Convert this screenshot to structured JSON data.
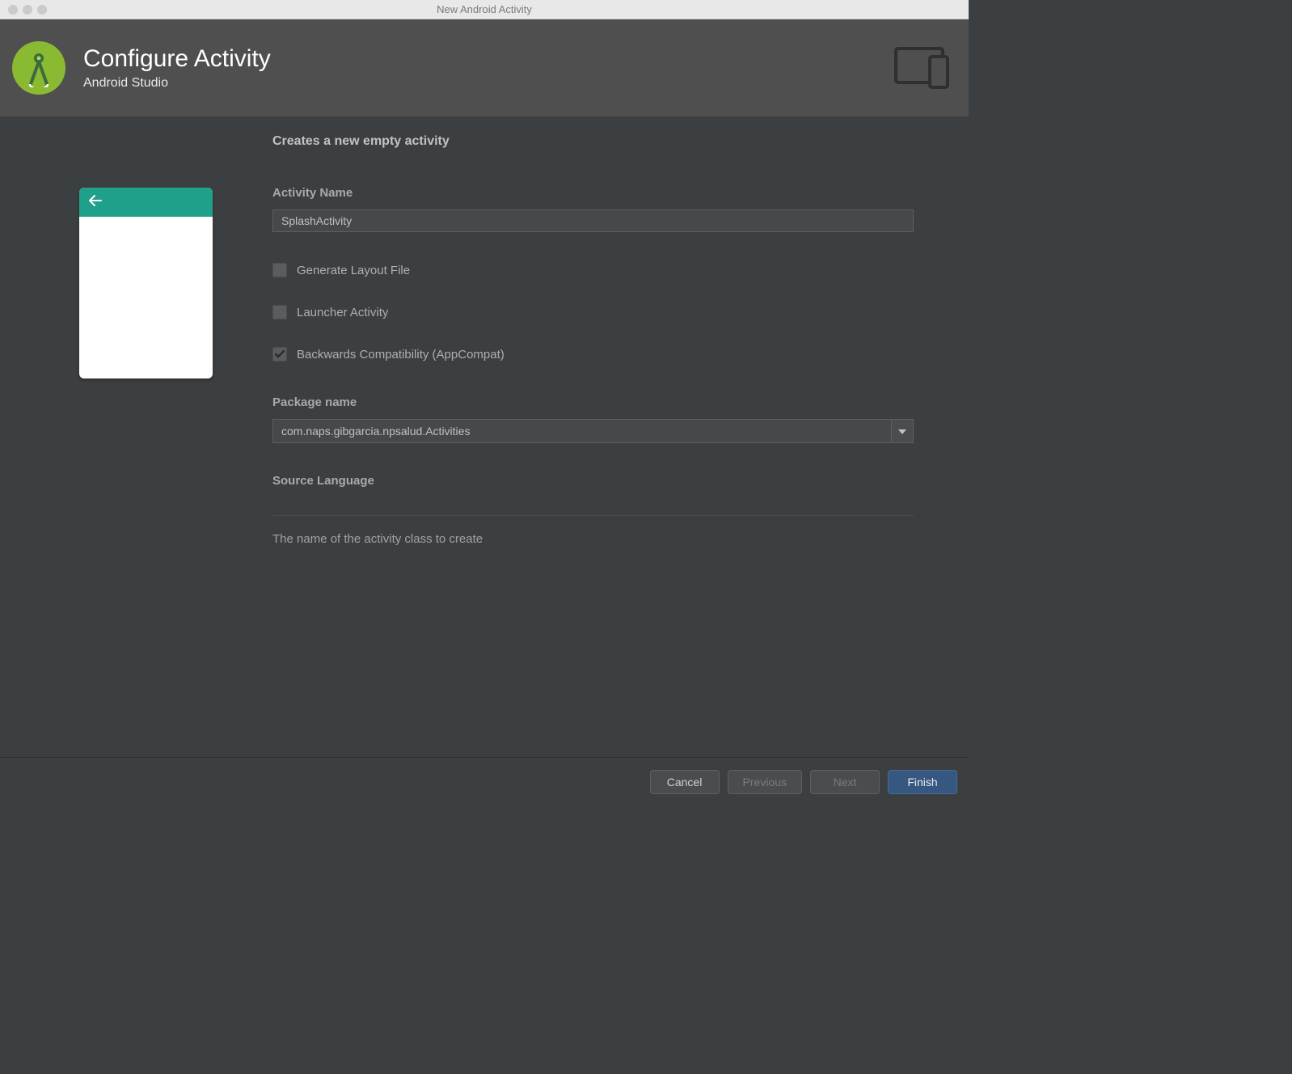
{
  "window": {
    "title": "New Android Activity"
  },
  "header": {
    "title": "Configure Activity",
    "subtitle": "Android Studio"
  },
  "form": {
    "heading": "Creates a new empty activity",
    "activityName": {
      "label": "Activity Name",
      "value": "SplashActivity"
    },
    "generateLayout": {
      "label": "Generate Layout File",
      "checked": false
    },
    "launcherActivity": {
      "label": "Launcher Activity",
      "checked": false
    },
    "backwardsCompat": {
      "label": "Backwards Compatibility (AppCompat)",
      "checked": true
    },
    "packageName": {
      "label": "Package name",
      "value": "com.naps.gibgarcia.npsalud.Activities"
    },
    "sourceLanguage": {
      "label": "Source Language"
    },
    "help": "The name of the activity class to create"
  },
  "footer": {
    "cancel": "Cancel",
    "previous": "Previous",
    "next": "Next",
    "finish": "Finish"
  }
}
